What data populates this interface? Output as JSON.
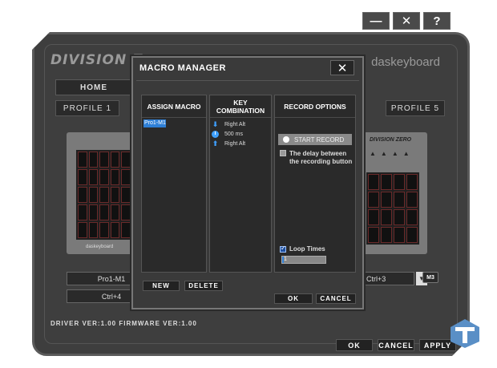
{
  "window_controls": {
    "minimize": "—",
    "close": "✕",
    "help": "?"
  },
  "app": {
    "logo_left": "DIVISION Z",
    "logo_right": "daskeyboard",
    "home_label": "HOME",
    "profile_left": "PROFILE 1",
    "profile_right": "PROFILE 5",
    "keyboard_left_brand": "daskeyboard",
    "keyboard_right_brand": "DIVISION ZERO",
    "field_macro": "Pro1-M1",
    "field_keys": "Ctrl+4",
    "field_right": "Ctrl+3",
    "m3_label": "M3",
    "version_text": "DRIVER VER:1.00   FIRMWARE VER:1.00",
    "ok_label": "OK",
    "cancel_label": "CANCEL",
    "apply_label": "APPLY"
  },
  "modal": {
    "title": "MACRO MANAGER",
    "close_label": "✕",
    "columns": {
      "assign_macro": "ASSIGN MACRO",
      "key_combination": "KEY COMBINATION",
      "record_options": "RECORD OPTIONS"
    },
    "macros": [
      "Pro1-M1"
    ],
    "key_events": [
      {
        "icon": "arrow-down-icon",
        "text": "Right Alt"
      },
      {
        "icon": "clock-icon",
        "text": "500 ms"
      },
      {
        "icon": "arrow-up-icon",
        "text": "Right Alt"
      }
    ],
    "start_record_label": "START RECORD",
    "delay_label": "The delay between the recording button",
    "delay_checked": false,
    "loop_label": "Loop Times",
    "loop_checked": true,
    "loop_value": "1",
    "new_label": "NEW",
    "delete_label": "DELETE",
    "ok_label": "OK",
    "cancel_label": "CANCEL"
  }
}
